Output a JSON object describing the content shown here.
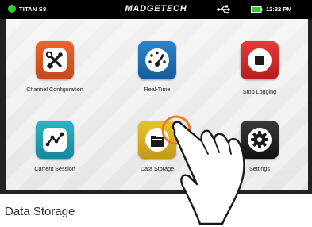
{
  "status_bar": {
    "device_name": "TITAN S8",
    "brand": "MADGETECH",
    "time": "12:32 PM",
    "usb_icon": "usb-icon",
    "battery_icon": "battery-icon",
    "status_color": "#2ecc2e"
  },
  "menu": {
    "items": [
      {
        "label": "Channel Configuration",
        "icon": "tools-icon",
        "color": "#d9541e"
      },
      {
        "label": "Real-Time",
        "icon": "gauge-icon",
        "color": "#1f6fb5"
      },
      {
        "label": "Stop Logging",
        "icon": "stop-icon",
        "color": "#d42a2a"
      },
      {
        "label": "Current Session",
        "icon": "graph-icon",
        "color": "#1e9fb2"
      },
      {
        "label": "Data Storage",
        "icon": "folder-icon",
        "color": "#d8b324"
      },
      {
        "label": "Settings",
        "icon": "gear-icon",
        "color": "#222222"
      }
    ],
    "selected": "Data Storage"
  },
  "caption": "Data Storage"
}
